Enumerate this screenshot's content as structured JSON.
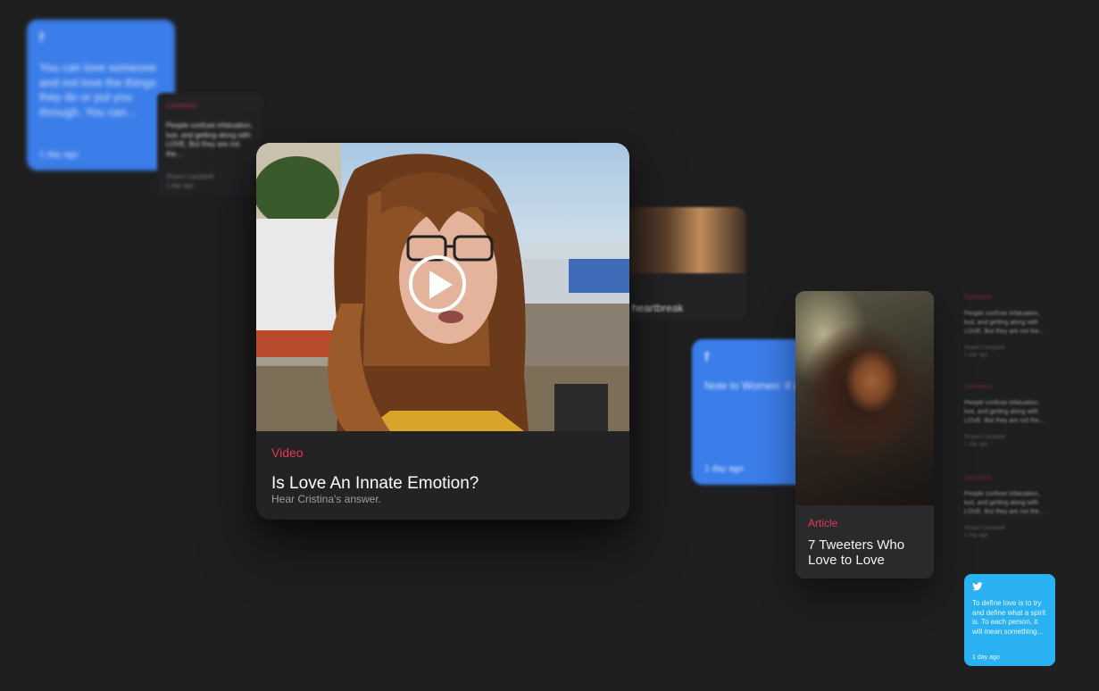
{
  "facebook_card_1": {
    "logo": "f",
    "text": "You can love someone and not love the things they do or put you through. You can...",
    "time": "1 day ago",
    "icon": "facebook-icon"
  },
  "comment_card_1": {
    "kind": "Comment",
    "text": "People confuse infatuation, lust, and getting along with LOVE. But they are not the...",
    "author": "Shawn Campbell",
    "time": "1 day ago"
  },
  "heartbreak_card": {
    "title": "heartbreak"
  },
  "facebook_card_2": {
    "logo": "f",
    "text": "Note to Women: If a man Cheats, Lies or consciously mistreats you, stop fighting fire with fire...",
    "time": "1 day ago",
    "icon": "facebook-icon"
  },
  "main_card": {
    "kind": "Video",
    "title": "Is Love An Innate Emotion?",
    "subtitle": "Hear Cristina's answer.",
    "play_icon": "play-icon"
  },
  "article_card": {
    "kind": "Article",
    "title": "7 Tweeters Who Love to Love"
  },
  "right_comments": [
    {
      "kind": "Comment",
      "text": "People confuse infatuation, lust, and getting along with LOVE. But they are not the...",
      "author": "Shawn Campbell",
      "time": "1 day ago"
    },
    {
      "kind": "Comment",
      "text": "People confuse infatuation, lust, and getting along with LOVE. But they are not the...",
      "author": "Shawn Campbell",
      "time": "1 day ago"
    },
    {
      "kind": "Comment",
      "text": "People confuse infatuation, lust, and getting along with LOVE. But they are not the...",
      "author": "Shawn Campbell",
      "time": "1 day ago"
    }
  ],
  "twitter_card": {
    "text": "To define love is to try and define what a spirit is. To each person, it will mean something...",
    "time": "1 day ago",
    "icon": "twitter-icon"
  },
  "colors": {
    "background": "#1f1f20",
    "facebook_blue": "#3b7de9",
    "twitter_blue": "#2ab1f1",
    "accent_pink": "#e3365a"
  }
}
